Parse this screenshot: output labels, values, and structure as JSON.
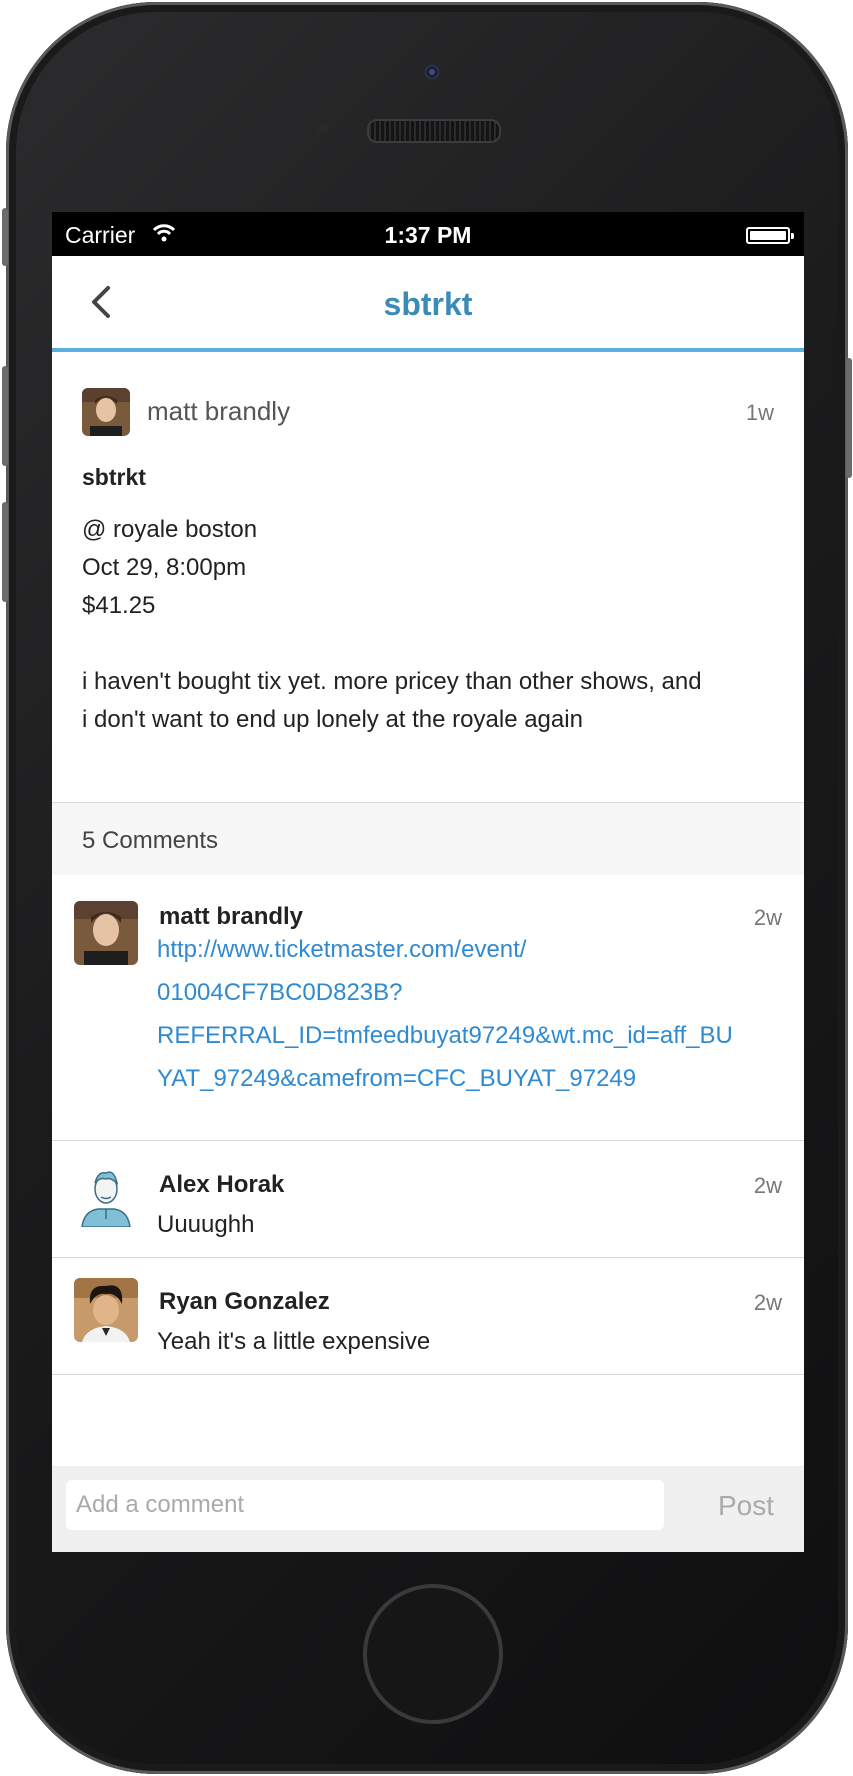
{
  "status_bar": {
    "carrier": "Carrier",
    "time": "1:37 PM"
  },
  "nav": {
    "title": "sbtrkt",
    "back_icon": "chevron-left-icon"
  },
  "post": {
    "author": "matt brandly",
    "time": "1w",
    "title": "sbtrkt",
    "body_lines": [
      "@ royale boston",
      "Oct 29, 8:00pm",
      "$41.25",
      "",
      "i haven't bought tix yet. more pricey than other shows, and",
      "i don't want to end up lonely at the royale again"
    ]
  },
  "comments": {
    "count_label": "5 Comments",
    "items": [
      {
        "author": "matt brandly",
        "time": "2w",
        "link_lines": [
          "http://www.ticketmaster.com/event/",
          "01004CF7BC0D823B?",
          "REFERRAL_ID=tmfeedbuyat97249&wt.mc_id=aff_BU",
          "YAT_97249&camefrom=CFC_BUYAT_97249"
        ]
      },
      {
        "author": "Alex Horak",
        "time": "2w",
        "text": "Uuuughh"
      },
      {
        "author": "Ryan Gonzalez",
        "time": "2w",
        "text": "Yeah it's a little expensive"
      }
    ]
  },
  "composer": {
    "placeholder": "Add a comment",
    "post_label": "Post"
  },
  "colors": {
    "accent": "#3a8bb6",
    "divider": "#5aaee0",
    "link": "#2f8ad2"
  }
}
